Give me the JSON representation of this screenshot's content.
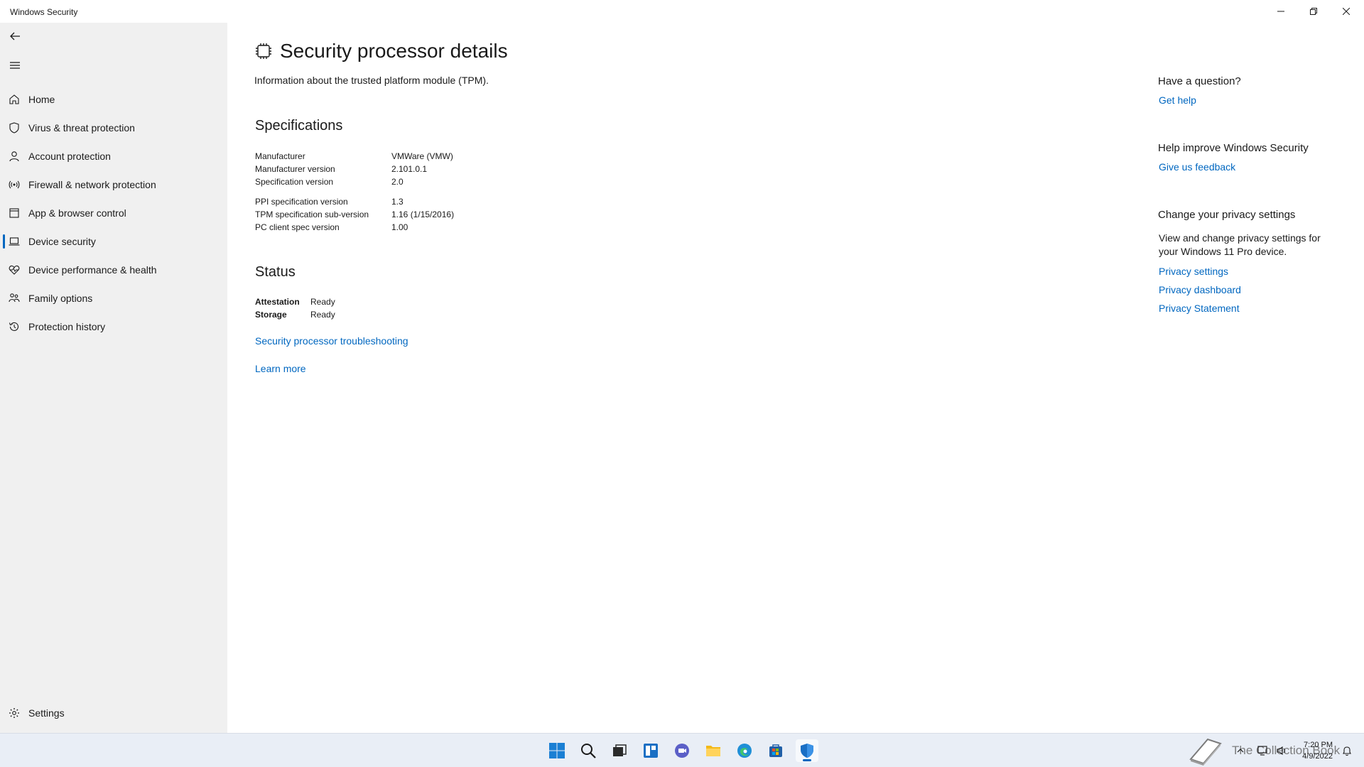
{
  "window": {
    "title": "Windows Security"
  },
  "sidebar": {
    "items": [
      {
        "label": "Home",
        "icon": "home-icon"
      },
      {
        "label": "Virus & threat protection",
        "icon": "shield-icon"
      },
      {
        "label": "Account protection",
        "icon": "person-icon"
      },
      {
        "label": "Firewall & network protection",
        "icon": "wifi-antenna-icon"
      },
      {
        "label": "App & browser control",
        "icon": "app-window-icon"
      },
      {
        "label": "Device security",
        "icon": "laptop-icon",
        "active": true
      },
      {
        "label": "Device performance & health",
        "icon": "heart-pulse-icon"
      },
      {
        "label": "Family options",
        "icon": "family-icon"
      },
      {
        "label": "Protection history",
        "icon": "history-icon"
      }
    ],
    "settings_label": "Settings"
  },
  "main": {
    "title": "Security processor details",
    "subtitle": "Information about the trusted platform module (TPM).",
    "specifications": {
      "heading": "Specifications",
      "rows": [
        {
          "label": "Manufacturer",
          "value": "VMWare (VMW)"
        },
        {
          "label": "Manufacturer version",
          "value": "2.101.0.1"
        },
        {
          "label": "Specification version",
          "value": "2.0"
        },
        {
          "label": "PPI specification version",
          "value": "1.3"
        },
        {
          "label": "TPM specification sub-version",
          "value": "1.16 (1/15/2016)"
        },
        {
          "label": "PC client spec version",
          "value": "1.00"
        }
      ]
    },
    "status": {
      "heading": "Status",
      "rows": [
        {
          "label": "Attestation",
          "value": "Ready"
        },
        {
          "label": "Storage",
          "value": "Ready"
        }
      ]
    },
    "troubleshooting_link": "Security processor troubleshooting",
    "learn_more_link": "Learn more"
  },
  "aside": {
    "question_heading": "Have a question?",
    "get_help": "Get help",
    "improve_heading": "Help improve Windows Security",
    "feedback": "Give us feedback",
    "privacy_heading": "Change your privacy settings",
    "privacy_text": "View and change privacy settings for your Windows 11 Pro device.",
    "privacy_settings": "Privacy settings",
    "privacy_dashboard": "Privacy dashboard",
    "privacy_statement": "Privacy Statement"
  },
  "taskbar": {
    "time": "7:20 PM",
    "date": "4/9/2022",
    "watermark": "The Collection Book"
  },
  "colors": {
    "accent": "#0067c0",
    "sidebar_bg": "#f0f0f0",
    "taskbar_bg": "#e9eef6"
  }
}
